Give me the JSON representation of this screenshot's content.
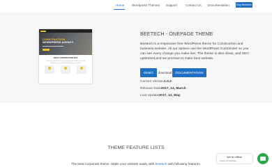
{
  "nav": {
    "items": [
      "Home",
      "Wordpress Themes",
      "Support",
      "Contact Us",
      "Documentation"
    ],
    "active": "Home",
    "buy_label": "Buy Beetech"
  },
  "preview": {
    "hero_line1": "CONSTRUCTION",
    "hero_line2": "WORDPRESS AGENCY",
    "section_label": "ABOUT CONSTRUCTION SITE"
  },
  "theme": {
    "title": "BEETECH - ONEPAGE THEME",
    "description": "Beetech is a responsive free WordPress theme for Construction and business website. All our options use the WordPress Customizer so you can see every change you make live. The theme is also clean, and SEO optimized and we promise to make best website.",
    "demo_label": "DEMO",
    "download_label": "download",
    "docs_label": "DOCUMENTATION",
    "meta": [
      {
        "label": "Current Version",
        "value": "1.0.2"
      },
      {
        "label": "Release Date",
        "value": "2017, 14, March"
      },
      {
        "label": "Last Update",
        "value": "2017, 12, May"
      }
    ]
  },
  "features": {
    "title": "THEME FEATURE LISTS",
    "subtitle_pre": "The best Corporate theme. Make your website easily with ",
    "subtitle_hl": "beetech",
    "subtitle_post": " with following features."
  },
  "chat": {
    "title": "We're offline",
    "message": "Leave a message"
  },
  "colors": {
    "accent": "#1f6fc4",
    "chat_green": "#2aa845",
    "preview_yellow": "#e8c02b"
  }
}
